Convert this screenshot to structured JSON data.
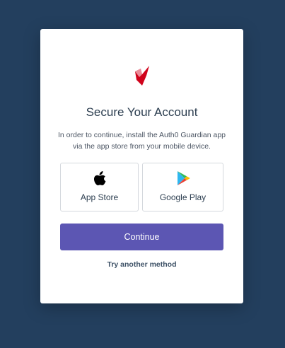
{
  "card": {
    "title": "Secure Your Account",
    "description": "In order to continue, install the Auth0 Guardian app via the app store from your mobile device."
  },
  "stores": {
    "app_store": {
      "label": "App Store",
      "icon": "apple-icon"
    },
    "google_play": {
      "label": "Google Play",
      "icon": "google-play-icon"
    }
  },
  "actions": {
    "continue_label": "Continue",
    "alternate_label": "Try another method"
  },
  "colors": {
    "background": "#233f5e",
    "primary": "#5c56b3",
    "brand_red": "#d0021b"
  }
}
